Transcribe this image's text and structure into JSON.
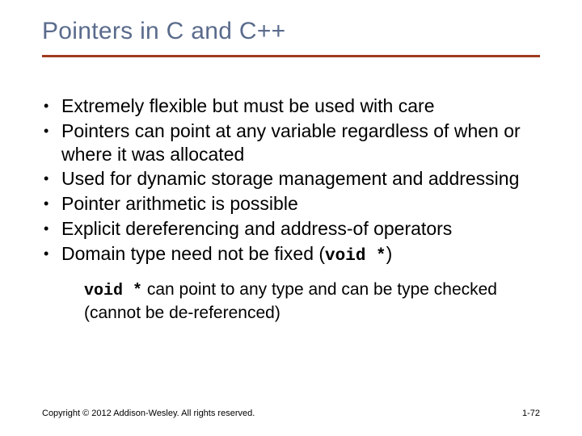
{
  "title": "Pointers in C and C++",
  "bullets": [
    "Extremely flexible but must be used with care",
    "Pointers can point at any variable regardless of when or where it was allocated",
    "Used for dynamic storage management and addressing",
    "Pointer arithmetic is possible",
    "Explicit dereferencing and address-of operators"
  ],
  "lastBullet": {
    "prefix": "Domain type need not be fixed (",
    "code": "void *",
    "suffix": ")"
  },
  "sub": {
    "code": "void *",
    "rest": " can point to any type and can be type checked (cannot be de-referenced)"
  },
  "footer": {
    "copyright": "Copyright © 2012 Addison-Wesley. All rights reserved.",
    "page": "1-72"
  }
}
